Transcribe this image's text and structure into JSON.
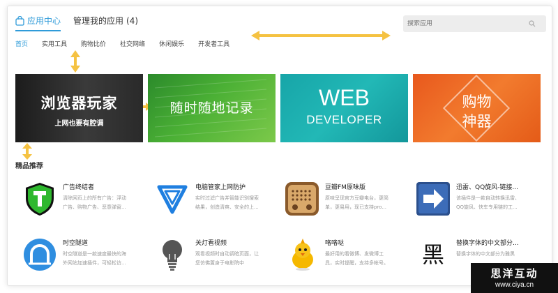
{
  "header": {
    "tab_active": "应用中心",
    "tab_manage": "管理我的应用",
    "tab_manage_count": "(4)"
  },
  "search": {
    "placeholder": "搜索应用"
  },
  "subnav": [
    {
      "label": "首页",
      "active": true
    },
    {
      "label": "实用工具"
    },
    {
      "label": "购物比价"
    },
    {
      "label": "社交网络"
    },
    {
      "label": "休闲娱乐"
    },
    {
      "label": "开发者工具"
    }
  ],
  "banners": {
    "b1": {
      "title": "浏览器玩家",
      "subtitle": "上网也要有腔调"
    },
    "b2": {
      "title": "随时随地记录"
    },
    "b3": {
      "title": "WEB",
      "subtitle": "DEVELOPER"
    },
    "b4": {
      "line1": "购物",
      "line2": "神器"
    }
  },
  "section": {
    "title": "精品推荐"
  },
  "apps": [
    {
      "name": "广告终结者",
      "desc": "清除网页上的所有广告：浮动广告、购物广告、恶意弹窗...",
      "icon": "shield-t-icon"
    },
    {
      "name": "电脑管家上网防护",
      "desc": "实时过滤广告并智能识别搜索结果，创造清爽、安全的上...",
      "icon": "tencent-shield-icon"
    },
    {
      "name": "豆瓣FM原味版",
      "desc": "原味呈现官方豆瓣电台，更简单，更易用，现已支持pro...",
      "icon": "radio-icon"
    },
    {
      "name": "迅雷、QQ旋风-链接...",
      "desc": "该插件是一款自动转换迅雷、QQ旋风、快车专用链的工...",
      "icon": "arrow-right-icon"
    },
    {
      "name": "时空隧道",
      "desc": "时空隧道是一款速度最快的海外网站加速插件，可轻松访...",
      "icon": "tunnel-icon"
    },
    {
      "name": "关灯看视频",
      "desc": "观看视频时自动调暗页面，让您仿佛置身于电影院中",
      "icon": "lightbulb-icon"
    },
    {
      "name": "咯咯哒",
      "desc": "最好用的看微博、发微博工具，实时提醒，支持多帐号。",
      "icon": "chick-icon"
    },
    {
      "name": "替换字体的中文部分...",
      "desc": "替换字体的中文部分为雅黑",
      "icon": "hei-char-icon",
      "glyph": "黑"
    }
  ],
  "watermark": {
    "line1": "思洋互动",
    "line2": "www.ciya.cn"
  },
  "colors": {
    "accent": "#2f9bd9",
    "annotation_arrow": "#f5c242"
  }
}
